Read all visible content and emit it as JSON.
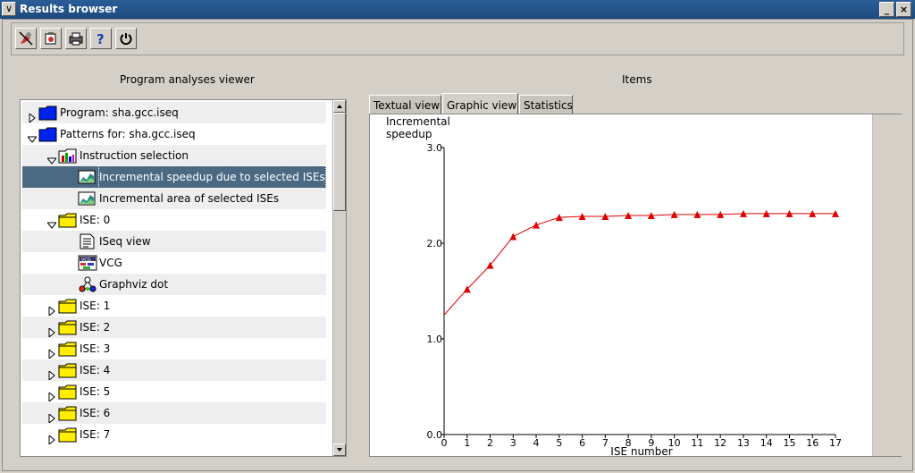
{
  "window": {
    "title": "Results browser"
  },
  "toolbar": {
    "buttons": [
      "run-icon",
      "export-icon",
      "print-icon",
      "help-icon",
      "power-icon"
    ]
  },
  "left": {
    "header": "Program analyses viewer",
    "tree": [
      {
        "label": "Program: sha.gcc.iseq",
        "icon": "blue-folder-icon",
        "level": 0,
        "expander": "collapsed"
      },
      {
        "label": "Patterns for: sha.gcc.iseq",
        "icon": "blue-folder-icon",
        "level": 0,
        "expander": "expanded"
      },
      {
        "label": "Instruction selection",
        "icon": "chart-folder-icon",
        "level": 1,
        "expander": "expanded"
      },
      {
        "label": "Incremental speedup due to selected ISEs",
        "icon": "area-chart-icon",
        "level": 2,
        "expander": "none",
        "selected": true
      },
      {
        "label": "Incremental area of selected ISEs",
        "icon": "area-chart-icon",
        "level": 2,
        "expander": "none"
      },
      {
        "label": "ISE: 0",
        "icon": "yellow-folder-icon",
        "level": 1,
        "expander": "expanded"
      },
      {
        "label": "ISeq view",
        "icon": "document-icon",
        "level": 2,
        "expander": "none"
      },
      {
        "label": "VCG",
        "icon": "vcg-icon",
        "level": 2,
        "expander": "none"
      },
      {
        "label": "Graphviz dot",
        "icon": "graphviz-icon",
        "level": 2,
        "expander": "none"
      },
      {
        "label": "ISE: 1",
        "icon": "yellow-folder-icon",
        "level": 1,
        "expander": "collapsed"
      },
      {
        "label": "ISE: 2",
        "icon": "yellow-folder-icon",
        "level": 1,
        "expander": "collapsed"
      },
      {
        "label": "ISE: 3",
        "icon": "yellow-folder-icon",
        "level": 1,
        "expander": "collapsed"
      },
      {
        "label": "ISE: 4",
        "icon": "yellow-folder-icon",
        "level": 1,
        "expander": "collapsed"
      },
      {
        "label": "ISE: 5",
        "icon": "yellow-folder-icon",
        "level": 1,
        "expander": "collapsed"
      },
      {
        "label": "ISE: 6",
        "icon": "yellow-folder-icon",
        "level": 1,
        "expander": "collapsed"
      },
      {
        "label": "ISE: 7",
        "icon": "yellow-folder-icon",
        "level": 1,
        "expander": "collapsed"
      }
    ]
  },
  "right": {
    "header": "Items",
    "tabs": [
      {
        "label": "Textual view",
        "active": false
      },
      {
        "label": "Graphic view",
        "active": true
      },
      {
        "label": "Statistics",
        "active": false
      }
    ]
  },
  "chart_data": {
    "type": "line",
    "title": "",
    "ylabel_lines": [
      "Incremental",
      "speedup"
    ],
    "xlabel": "ISE number",
    "x": [
      0,
      1,
      2,
      3,
      4,
      5,
      6,
      7,
      8,
      9,
      10,
      11,
      12,
      13,
      14,
      15,
      16,
      17
    ],
    "x_ticks": [
      "0",
      "1",
      "2",
      "3",
      "4",
      "5",
      "6",
      "7",
      "8",
      "9",
      "10",
      "11",
      "12",
      "13",
      "14",
      "15",
      "16",
      "17"
    ],
    "y_ticks": [
      "0.0",
      "1.0",
      "2.0",
      "3.0"
    ],
    "ylim": [
      0,
      3.0
    ],
    "xlim": [
      0,
      17
    ],
    "series": [
      {
        "values": [
          1.25,
          1.52,
          1.77,
          2.07,
          2.19,
          2.27,
          2.28,
          2.28,
          2.29,
          2.29,
          2.3,
          2.3,
          2.3,
          2.31,
          2.31,
          2.31,
          2.31,
          2.31
        ],
        "color": "#e00000",
        "marker": "triangle",
        "marker_at": [
          1,
          2,
          3,
          4,
          5,
          6,
          7,
          8,
          9,
          10,
          11,
          12,
          13,
          14,
          15,
          16,
          17
        ]
      }
    ],
    "grid": false,
    "legend": "none"
  }
}
